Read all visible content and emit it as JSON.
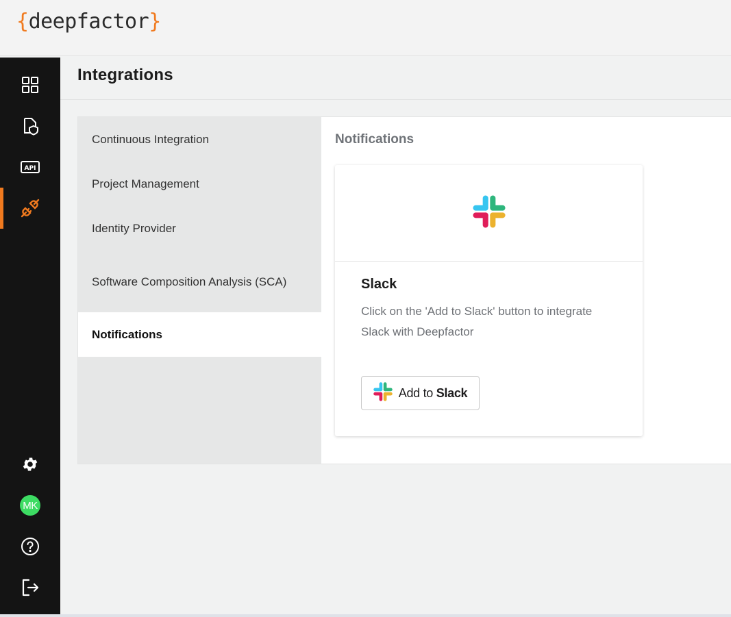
{
  "brand": {
    "open_brace": "{",
    "name": "deepfactor",
    "close_brace": "}"
  },
  "page": {
    "title": "Integrations"
  },
  "rail": {
    "items": [
      {
        "icon": "dashboard-icon"
      },
      {
        "icon": "document-shield-icon"
      },
      {
        "icon": "api-icon",
        "text": "API"
      },
      {
        "icon": "plug-icon",
        "active": true
      }
    ],
    "bottom": [
      {
        "icon": "gear-icon"
      },
      {
        "icon": "avatar",
        "initials": "MK"
      },
      {
        "icon": "help-icon"
      },
      {
        "icon": "logout-icon"
      }
    ]
  },
  "categories": [
    {
      "label": "Continuous Integration"
    },
    {
      "label": "Project Management"
    },
    {
      "label": "Identity Provider"
    },
    {
      "label": "Software Composition Analysis (SCA)"
    },
    {
      "label": "Notifications",
      "active": true
    }
  ],
  "content": {
    "title": "Notifications",
    "card": {
      "name": "Slack",
      "description": "Click on the 'Add to Slack' button to integrate Slack with Deepfactor",
      "button": {
        "prefix": "Add to",
        "bold": "Slack"
      }
    }
  },
  "colors": {
    "accent": "#f07a1f",
    "rail": "#141414",
    "avatar": "#3ddc63"
  }
}
